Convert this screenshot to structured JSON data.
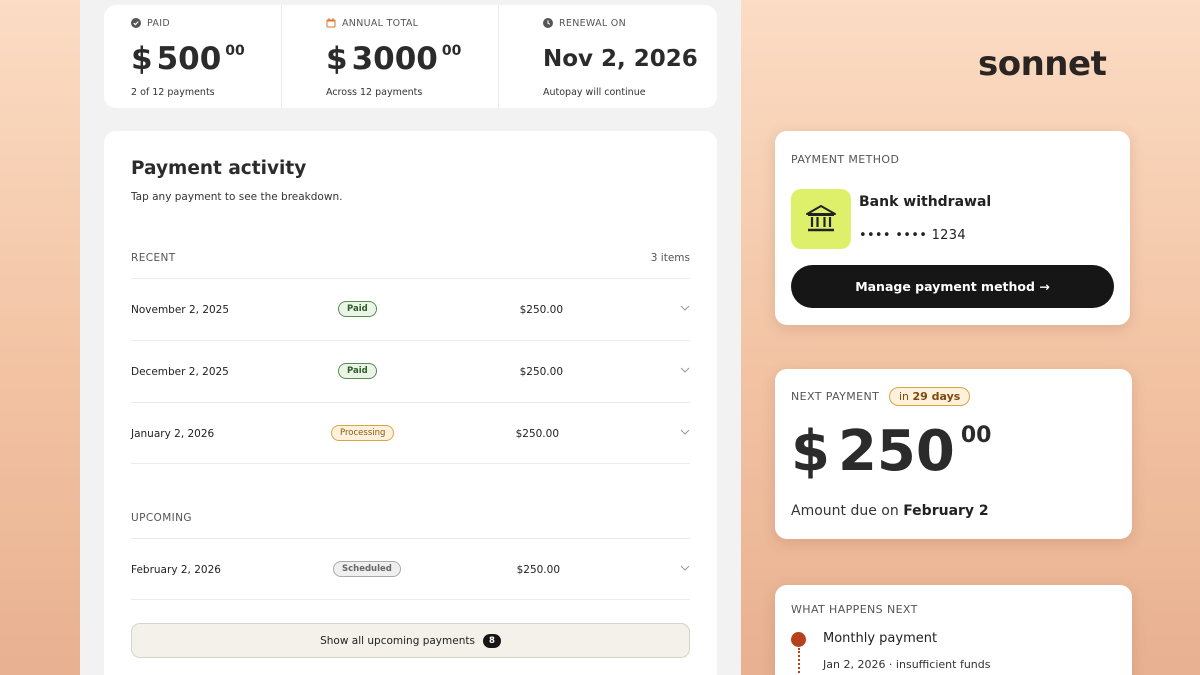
{
  "summary": {
    "paid": {
      "label": "PAID",
      "dollar": "$",
      "whole": "500",
      "cents": "00",
      "sub": "2 of 12 payments"
    },
    "annual": {
      "label": "ANNUAL TOTAL",
      "dollar": "$",
      "whole": "3000",
      "cents": "00",
      "sub": "Across 12 payments"
    },
    "renewal": {
      "label": "RENEWAL ON",
      "date": "Nov 2, 2026",
      "sub": "Autopay will continue"
    }
  },
  "activity": {
    "title": "Payment activity",
    "subtitle": "Tap any payment to see the breakdown.",
    "recent_label": "RECENT",
    "recent_count": "3 items",
    "recent": [
      {
        "date": "November 2, 2025",
        "status": "Paid",
        "amount": "$250.00"
      },
      {
        "date": "December 2, 2025",
        "status": "Paid",
        "amount": "$250.00"
      },
      {
        "date": "January 2, 2026",
        "status": "Processing",
        "amount": "$250.00"
      }
    ],
    "upcoming_label": "UPCOMING",
    "upcoming": [
      {
        "date": "February 2, 2026",
        "status": "Scheduled",
        "amount": "$250.00"
      }
    ],
    "show_all_label": "Show all upcoming payments",
    "show_all_count": "8"
  },
  "brand": {
    "logo": "sonnet"
  },
  "payment_method": {
    "label": "PAYMENT METHOD",
    "name": "Bank withdrawal",
    "masked": "•••• •••• 1234",
    "button": "Manage payment method →",
    "icon": "bank-icon"
  },
  "next_payment": {
    "label": "NEXT PAYMENT",
    "pill_prefix": "in ",
    "pill_days": "29 days",
    "dollar": "$",
    "whole": "250",
    "cents": "00",
    "due_prefix": "Amount due on ",
    "due_date": "February 2"
  },
  "what_next": {
    "label": "WHAT HAPPENS NEXT",
    "title": "Monthly payment",
    "sub": "Jan 2, 2026 · insufficient funds"
  },
  "colors": {
    "accent_lime": "#def06a",
    "dot": "#b5421c",
    "paid_green": "#2e5e2e",
    "processing_amber": "#d9a445"
  }
}
